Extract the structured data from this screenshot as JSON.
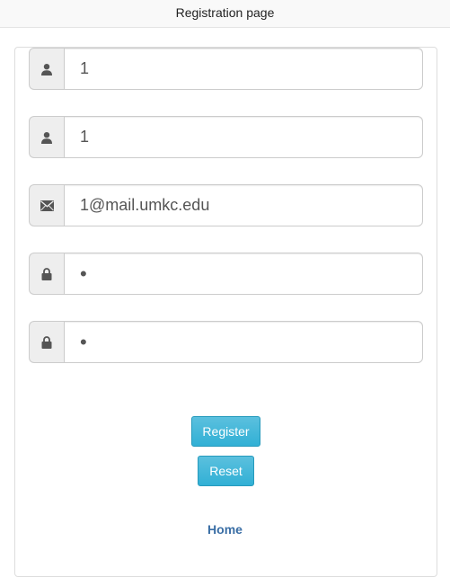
{
  "header": {
    "title": "Registration page"
  },
  "form": {
    "fields": [
      {
        "icon": "user-icon",
        "value": "1"
      },
      {
        "icon": "user-icon",
        "value": "1"
      },
      {
        "icon": "envelope-icon",
        "value": "1@mail.umkc.edu"
      },
      {
        "icon": "lock-icon",
        "value": "•"
      },
      {
        "icon": "lock-icon",
        "value": "•"
      }
    ],
    "register_label": "Register",
    "reset_label": "Reset"
  },
  "footer": {
    "home_label": "Home"
  },
  "colors": {
    "button": "#5bc0de",
    "link": "#3a6ea5",
    "addon_bg": "#eeeeee"
  }
}
